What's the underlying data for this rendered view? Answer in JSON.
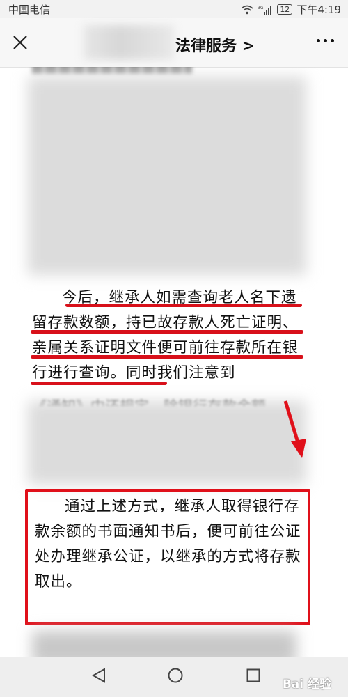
{
  "status_bar": {
    "carrier": "中国电信",
    "signal_label": "36",
    "battery": "12",
    "time": "下午4:19"
  },
  "nav": {
    "title": "法律服务 >",
    "close_icon": "close-icon",
    "more_icon": "more-icon"
  },
  "article": {
    "paragraph_1": "今后，继承人如需查询老人名下遗留存款数额，持已故存款人死亡证明、亲属关系证明文件便可前往存款所在银行进行查询。同时我们注意到",
    "partial_line": "《通知》中还规定，除银行存款余额",
    "paragraph_2": "通过上述方式，继承人取得银行存款余额的书面通知书后，便可前往公证处办理继承公证，以继承的方式将存款取出。"
  },
  "bottom_nav": {
    "back_icon": "triangle-back-icon",
    "home_icon": "circle-home-icon",
    "recent_icon": "square-recent-icon",
    "watermark": "Bai 经验"
  },
  "colors": {
    "highlight": "#e0101a",
    "background": "#ffffff"
  }
}
